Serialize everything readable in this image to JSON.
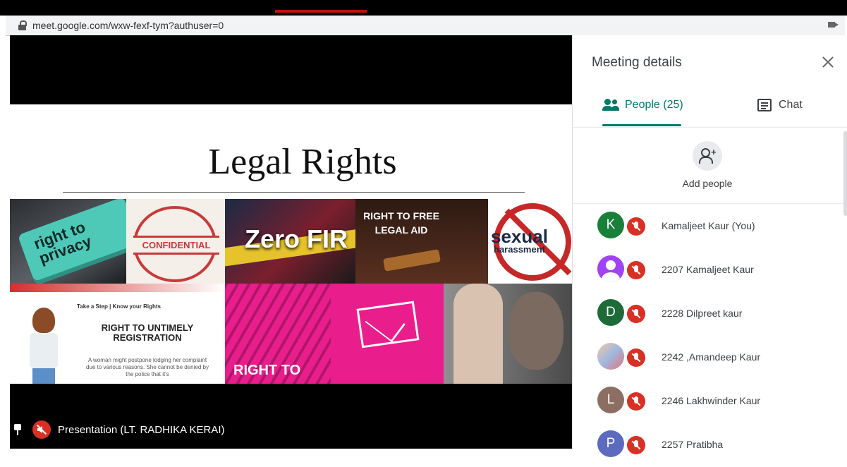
{
  "browser": {
    "url": "meet.google.com/wxw-fexf-tym?authuser=0"
  },
  "slide": {
    "title": "Legal Rights",
    "tiles": [
      {
        "text": "right to privacy"
      },
      {
        "text": "CONFIDENTIAL"
      },
      {
        "text": "Zero FIR"
      },
      {
        "text": "RIGHT TO FREE LEGAL AID"
      },
      {
        "text": "sexual",
        "text2": "harassment"
      },
      {
        "subtitle": "Take a Step | Know your Rights",
        "heading": "RIGHT TO UNTIMELY REGISTRATION",
        "body": "A woman might postpone lodging her complaint due to various reasons. She cannot be denied by the police that it's"
      },
      {
        "text": "RIGHT TO"
      }
    ]
  },
  "presentation": {
    "label": "Presentation (LT. RADHIKA KERAI)"
  },
  "panel": {
    "title": "Meeting details",
    "tabs": [
      {
        "label": "People (25)",
        "icon": "people-icon",
        "active": true
      },
      {
        "label": "Chat",
        "icon": "chat-icon",
        "active": false
      }
    ],
    "add_people_label": "Add people",
    "participants": [
      {
        "initial": "K",
        "name": "Kamaljeet Kaur (You)",
        "avatar_color": "#188038",
        "avatar_type": "initial"
      },
      {
        "initial": "",
        "name": "2207 Kamaljeet Kaur",
        "avatar_color": "#a142f4",
        "avatar_type": "generic"
      },
      {
        "initial": "D",
        "name": "2228 Dilpreet kaur",
        "avatar_color": "#1e6b3a",
        "avatar_type": "initial"
      },
      {
        "initial": "",
        "name": "2242 ,Amandeep Kaur",
        "avatar_color": "#cccccc",
        "avatar_type": "photo"
      },
      {
        "initial": "L",
        "name": "2246 Lakhwinder Kaur",
        "avatar_color": "#8d6e63",
        "avatar_type": "initial"
      },
      {
        "initial": "P",
        "name": "2257 Pratibha",
        "avatar_color": "#5c6bc0",
        "avatar_type": "initial"
      }
    ]
  },
  "colors": {
    "accent": "#00796b",
    "mute": "#d93025",
    "stage_bg": "#000000"
  }
}
